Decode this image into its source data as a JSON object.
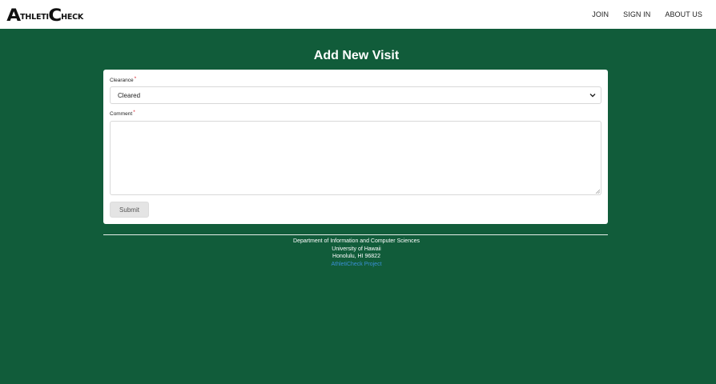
{
  "navbar": {
    "logo": {
      "first_big": "A",
      "first_small": "THLETI",
      "second_big": "C",
      "second_small": "HECK"
    },
    "links": [
      "JOIN",
      "SIGN IN",
      "ABOUT US"
    ]
  },
  "page": {
    "title": "Add New Visit"
  },
  "form": {
    "clearance_label": "Clearance",
    "clearance_value": "Cleared",
    "comment_label": "Comment",
    "comment_value": "",
    "required_mark": "*",
    "submit_label": "Submit"
  },
  "footer": {
    "line1": "Department of Information and Computer Sciences",
    "line2": "University of Hawaii",
    "line3": "Honolulu, HI 96822",
    "link": "AthletiCheck Project"
  },
  "colors": {
    "background": "#115c3a",
    "link": "#3b8fd6",
    "required": "#d9232e"
  },
  "icons": [
    "chevron-down-icon",
    "resize-grip-icon"
  ]
}
